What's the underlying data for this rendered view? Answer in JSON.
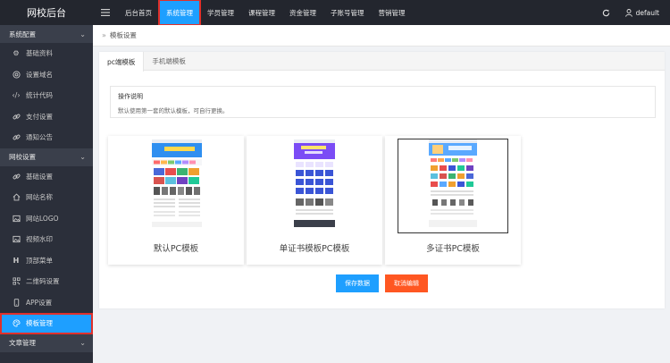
{
  "header": {
    "logo": "网校后台",
    "nav": [
      {
        "label": "后台首页"
      },
      {
        "label": "系统管理"
      },
      {
        "label": "学员管理"
      },
      {
        "label": "课程管理"
      },
      {
        "label": "资金管理"
      },
      {
        "label": "子账号管理"
      },
      {
        "label": "营销管理"
      }
    ],
    "user": "default"
  },
  "sidebar": {
    "group1": "系统配置",
    "group1_items": [
      {
        "label": "基础资料",
        "icon": "gear-icon"
      },
      {
        "label": "设置域名",
        "icon": "globe-icon"
      },
      {
        "label": "统计代码",
        "icon": "code-icon"
      },
      {
        "label": "支付设置",
        "icon": "link-icon"
      },
      {
        "label": "通知公告",
        "icon": "link-icon"
      }
    ],
    "group2": "网校设置",
    "group2_items": [
      {
        "label": "基础设置",
        "icon": "link-icon"
      },
      {
        "label": "网站名称",
        "icon": "home-icon"
      },
      {
        "label": "网站LOGO",
        "icon": "image-icon"
      },
      {
        "label": "视频水印",
        "icon": "image-icon"
      },
      {
        "label": "顶部菜单",
        "icon": "header-icon"
      },
      {
        "label": "二维码设置",
        "icon": "qrcode-icon"
      },
      {
        "label": "APP设置",
        "icon": "mobile-icon"
      },
      {
        "label": "模板管理",
        "icon": "palette-icon"
      }
    ],
    "group3": "文章管理"
  },
  "breadcrumb": "模板设置",
  "tabs": [
    {
      "label": "pc端模板"
    },
    {
      "label": "手机端模板"
    }
  ],
  "note": {
    "title": "操作说明",
    "text": "默认使用第一套的默认模板，可自行更换。"
  },
  "templates": [
    {
      "label": "默认PC模板"
    },
    {
      "label": "单证书模板PC模板"
    },
    {
      "label": "多证书PC模板"
    }
  ],
  "buttons": {
    "save": "保存数据",
    "cancel": "取消编辑"
  },
  "colors": {
    "topbar": "#23262e",
    "sidebar": "#2b2f3a",
    "accent": "#1e9fff",
    "cancel": "#ff5722",
    "highlight": "#e0302a"
  }
}
